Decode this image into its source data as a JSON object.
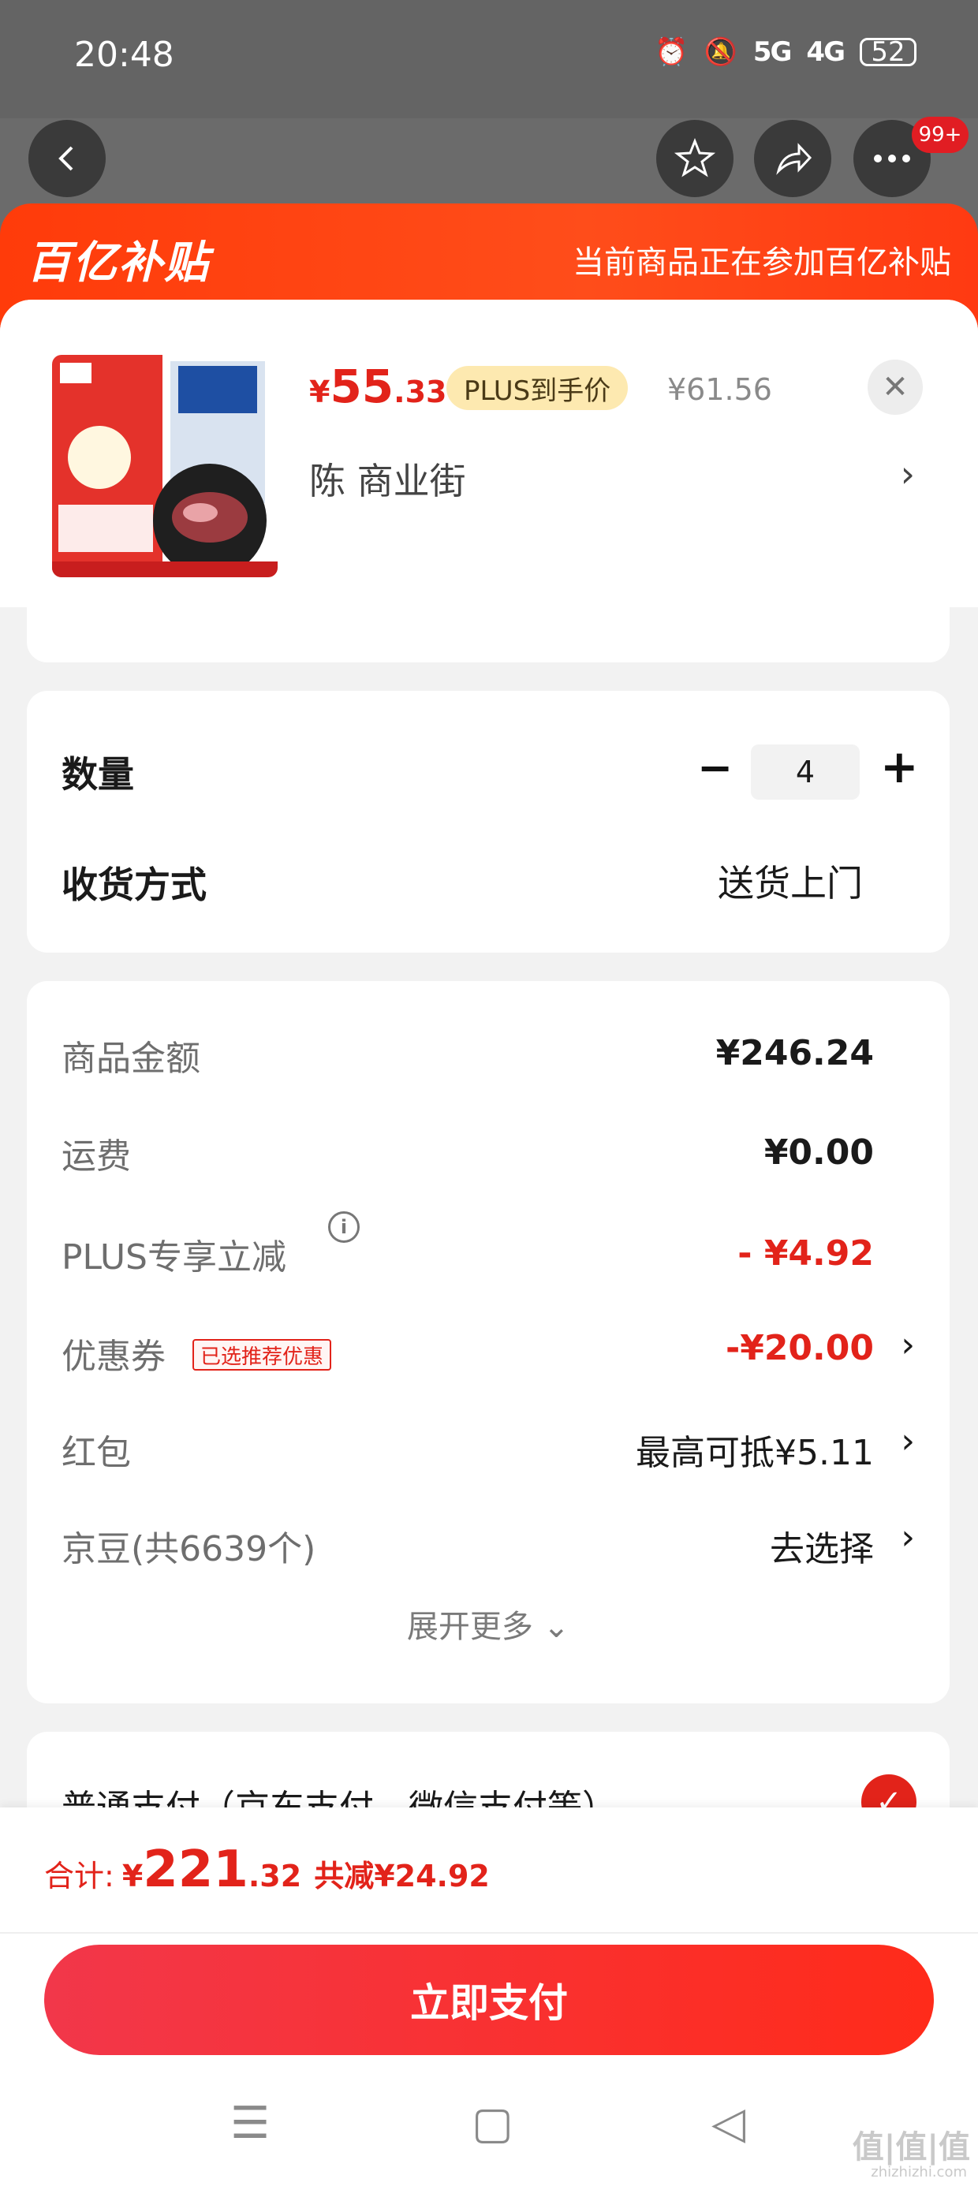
{
  "status_bar": {
    "time": "20:48",
    "signal_1": "5G",
    "signal_2": "4G",
    "battery": "52"
  },
  "nav": {
    "badge": "99+"
  },
  "banner": {
    "logo": "百亿补贴",
    "text": "当前商品正在参加百亿补贴"
  },
  "product": {
    "price_symbol": "¥",
    "price_int": "55",
    "price_dec": ".33",
    "plus_tag": "PLUS到手价",
    "original_price": "¥61.56",
    "address": "陈  商业街",
    "close": "✕"
  },
  "quantity": {
    "label": "数量",
    "minus": "−",
    "value": "4",
    "plus": "+"
  },
  "delivery": {
    "label": "收货方式",
    "value": "送货上门"
  },
  "fees": {
    "goods_label": "商品金额",
    "goods_value": "¥246.24",
    "shipping_label": "运费",
    "shipping_value": "¥0.00",
    "plus_label": "PLUS专享立减",
    "plus_value": "- ¥4.92",
    "coupon_label": "优惠券",
    "coupon_tag": "已选推荐优惠",
    "coupon_value": "-¥20.00",
    "redpacket_label": "红包",
    "redpacket_value": "最高可抵¥5.11",
    "jingdou_label": "京豆(共6639个)",
    "jingdou_value": "去选择",
    "expand": "展开更多 ⌄"
  },
  "payment": {
    "method_label": "普通支付（京东支付、微信支付等）"
  },
  "total": {
    "label": "合计:",
    "symbol": "¥",
    "int": "221",
    "dec": ".32",
    "saved": "共减¥24.92"
  },
  "pay_button": "立即支付",
  "watermark": "值|值|值",
  "watermark_sub": "zhizhizhi.com",
  "colors": {
    "accent": "#e2231a",
    "banner": "#ff3b0a",
    "plus_tag_bg": "#fde9b0"
  }
}
